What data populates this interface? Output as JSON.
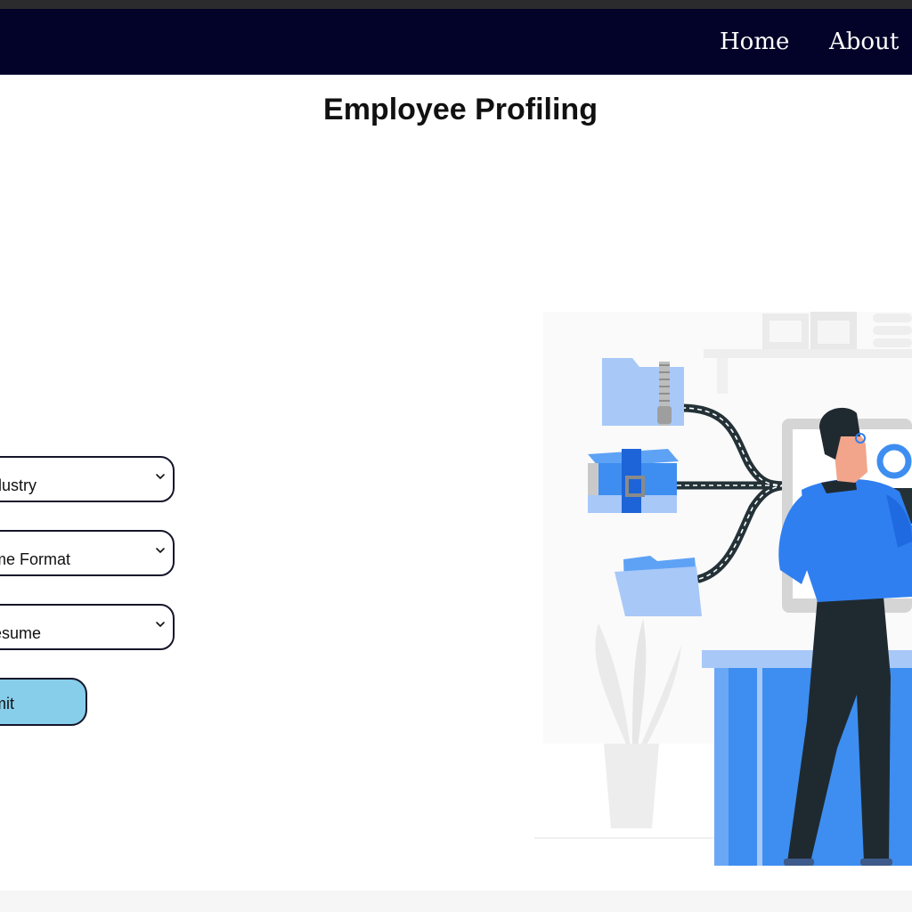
{
  "nav": {
    "home_label": "Home",
    "about_label": "About"
  },
  "page": {
    "title": "Employee Profiling"
  },
  "form": {
    "industry_select_text": "dustry",
    "format_select_text": "me Format",
    "resume_select_text": "esume",
    "submit_label": "omit"
  },
  "colors": {
    "navbar": "#030229",
    "submit_button": "#87ceeb",
    "accent_blue": "#2f80f2",
    "light_blue": "#a8c8f8"
  }
}
